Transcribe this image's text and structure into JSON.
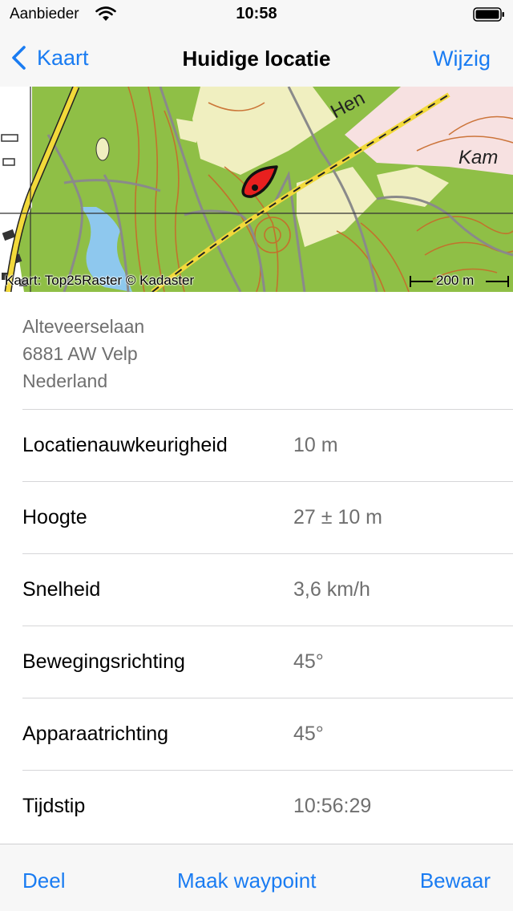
{
  "status_bar": {
    "carrier": "Aanbieder",
    "time": "10:58"
  },
  "nav": {
    "back_label": "Kaart",
    "title": "Huidige locatie",
    "edit_label": "Wijzig"
  },
  "map": {
    "attribution": "Kaart: Top25Raster © Kadaster",
    "scale_label": "200 m",
    "street_label_1": "Hen",
    "street_label_2": "Kam",
    "colors": {
      "forest": "#8fbf46",
      "field": "#f0efc0",
      "water": "#8ec8ee",
      "contour": "#c86a2a",
      "road": "#f2d93a",
      "marker": "#e8201f"
    }
  },
  "address": {
    "lines": [
      "Alteveerselaan",
      "6881 AW Velp",
      "Nederland"
    ]
  },
  "details": [
    {
      "label": "Locatienauwkeurigheid",
      "value": "10 m"
    },
    {
      "label": "Hoogte",
      "value": "27 ± 10 m"
    },
    {
      "label": "Snelheid",
      "value": "3,6 km/h"
    },
    {
      "label": "Bewegingsrichting",
      "value": "45°"
    },
    {
      "label": "Apparaatrichting",
      "value": "45°"
    },
    {
      "label": "Tijdstip",
      "value": "10:56:29"
    }
  ],
  "toolbar": {
    "share_label": "Deel",
    "waypoint_label": "Maak waypoint",
    "save_label": "Bewaar"
  },
  "accent_color": "#1a7cf2"
}
